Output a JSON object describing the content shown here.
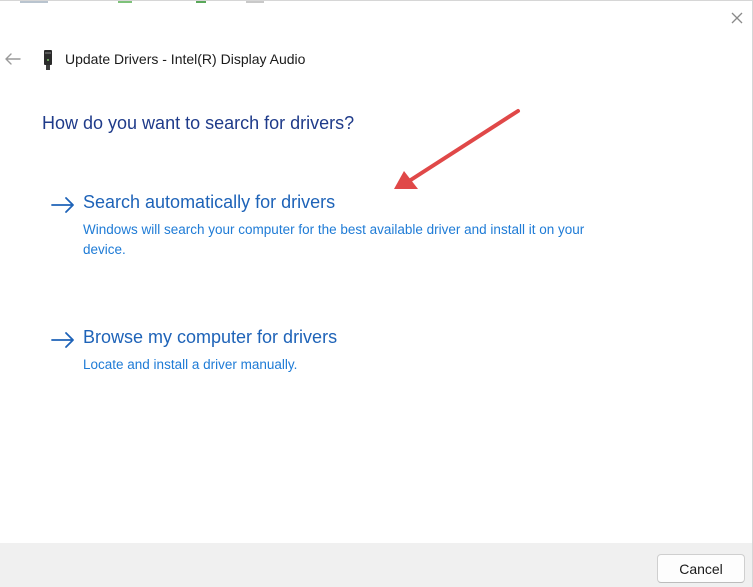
{
  "window": {
    "title": "Update Drivers - Intel(R) Display Audio",
    "icon": "device-icon"
  },
  "heading": "How do you want to search for drivers?",
  "options": [
    {
      "title": "Search automatically for drivers",
      "description": "Windows will search your computer for the best available driver and install it on your device.",
      "icon": "arrow-right-icon"
    },
    {
      "title": "Browse my computer for drivers",
      "description": "Locate and install a driver manually.",
      "icon": "arrow-right-icon"
    }
  ],
  "footer": {
    "cancel_label": "Cancel"
  },
  "colors": {
    "heading": "#1f3b8a",
    "link": "#1e63b8",
    "link_desc": "#1e7bd6",
    "annotation_arrow": "#e04848",
    "footer_bg": "#f0f0f0"
  }
}
